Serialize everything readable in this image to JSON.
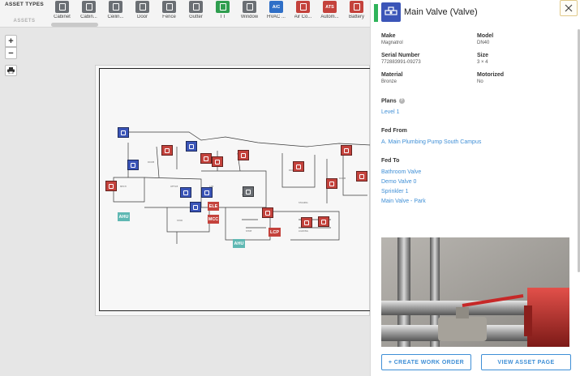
{
  "toolbar": {
    "asset_types_label": "ASSET TYPES",
    "assets_label": "ASSETS",
    "tools": [
      {
        "label": "Cabinet",
        "icon": "cabinet-icon",
        "color": "#6b6f74",
        "text": ""
      },
      {
        "label": "Cabin...",
        "icon": "cabinet-icon",
        "color": "#6b6f74",
        "text": ""
      },
      {
        "label": "Ceilin...",
        "icon": "ceiling-icon",
        "color": "#6b6f74",
        "text": ""
      },
      {
        "label": "Door",
        "icon": "door-icon",
        "color": "#6b6f74",
        "text": ""
      },
      {
        "label": "Fence",
        "icon": "fence-icon",
        "color": "#6b6f74",
        "text": ""
      },
      {
        "label": "Gutter",
        "icon": "gutter-icon",
        "color": "#6b6f74",
        "text": ""
      },
      {
        "label": "TT",
        "icon": "tt-icon",
        "color": "#2f9e4f",
        "text": ""
      },
      {
        "label": "Window",
        "icon": "window-icon",
        "color": "#6b6f74",
        "text": ""
      },
      {
        "label": "HVAC ...",
        "icon": "hvac-icon",
        "color": "#2f6fc7",
        "text": "A/C"
      },
      {
        "label": "Air Co...",
        "icon": "air-compressor-icon",
        "color": "#c4423c",
        "text": ""
      },
      {
        "label": "Autom...",
        "icon": "ats-icon",
        "color": "#c4423c",
        "text": "ATS"
      },
      {
        "label": "Battery",
        "icon": "battery-icon",
        "color": "#c4423c",
        "text": ""
      }
    ]
  },
  "map": {
    "zoom_in": "+",
    "zoom_out": "−",
    "tags": {
      "ahu_1": "AHU",
      "ahu_2": "AHU",
      "ele": "ELE",
      "lcp": "LCP",
      "mcc": "MCC"
    }
  },
  "panel": {
    "title": "Main Valve (Valve)",
    "colors": {
      "status": "#2fb35a",
      "icon_bg": "#3b55b8",
      "link": "#3f8fd6"
    },
    "fields": {
      "make": {
        "label": "Make",
        "value": "Magnatrol"
      },
      "model": {
        "label": "Model",
        "value": "DN40"
      },
      "serial": {
        "label": "Serial Number",
        "value": "772883991-09273"
      },
      "size": {
        "label": "Size",
        "value": "3 × 4"
      },
      "material": {
        "label": "Material",
        "value": "Bronze"
      },
      "motorized": {
        "label": "Motorized",
        "value": "No"
      }
    },
    "plans": {
      "label": "Plans",
      "info": "?",
      "items": [
        "Level 1"
      ]
    },
    "fed_from": {
      "label": "Fed From",
      "items": [
        "A. Main Plumbing Pump South Campus"
      ]
    },
    "fed_to": {
      "label": "Fed To",
      "items": [
        "Bathroom Valve",
        "Demo Valve 0",
        "Sprinkler 1",
        "Main Valve - Park"
      ]
    },
    "buttons": {
      "create_work_order": "+ CREATE WORK ORDER",
      "view_asset_page": "VIEW ASSET PAGE"
    }
  }
}
